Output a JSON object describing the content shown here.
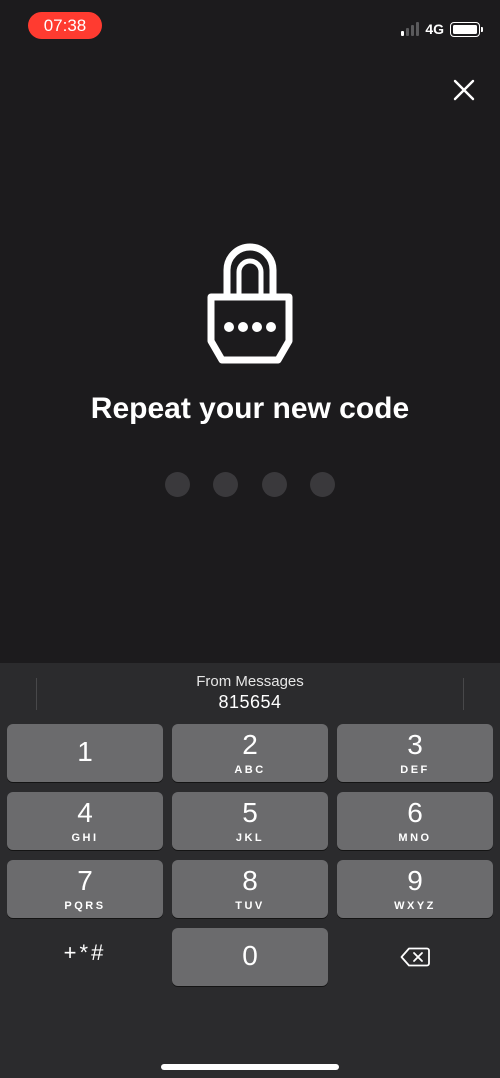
{
  "status": {
    "time": "07:38",
    "network": "4G",
    "signal_bars": 4,
    "signal_active": 1,
    "time_pill_color": "#ff3b30"
  },
  "close": {
    "icon": "close-icon"
  },
  "lock": {
    "icon": "padlock-icon"
  },
  "title": "Repeat your new code",
  "code_dots": {
    "count": 4,
    "filled": 0
  },
  "suggestion": {
    "source": "From Messages",
    "code": "815654"
  },
  "keypad": {
    "keys": [
      {
        "digit": "1",
        "letters": ""
      },
      {
        "digit": "2",
        "letters": "ABC"
      },
      {
        "digit": "3",
        "letters": "DEF"
      },
      {
        "digit": "4",
        "letters": "GHI"
      },
      {
        "digit": "5",
        "letters": "JKL"
      },
      {
        "digit": "6",
        "letters": "MNO"
      },
      {
        "digit": "7",
        "letters": "PQRS"
      },
      {
        "digit": "8",
        "letters": "TUV"
      },
      {
        "digit": "9",
        "letters": "WXYZ"
      },
      {
        "digit": "0",
        "letters": ""
      }
    ],
    "symbols": "+*#",
    "delete_icon": "backspace-icon"
  }
}
